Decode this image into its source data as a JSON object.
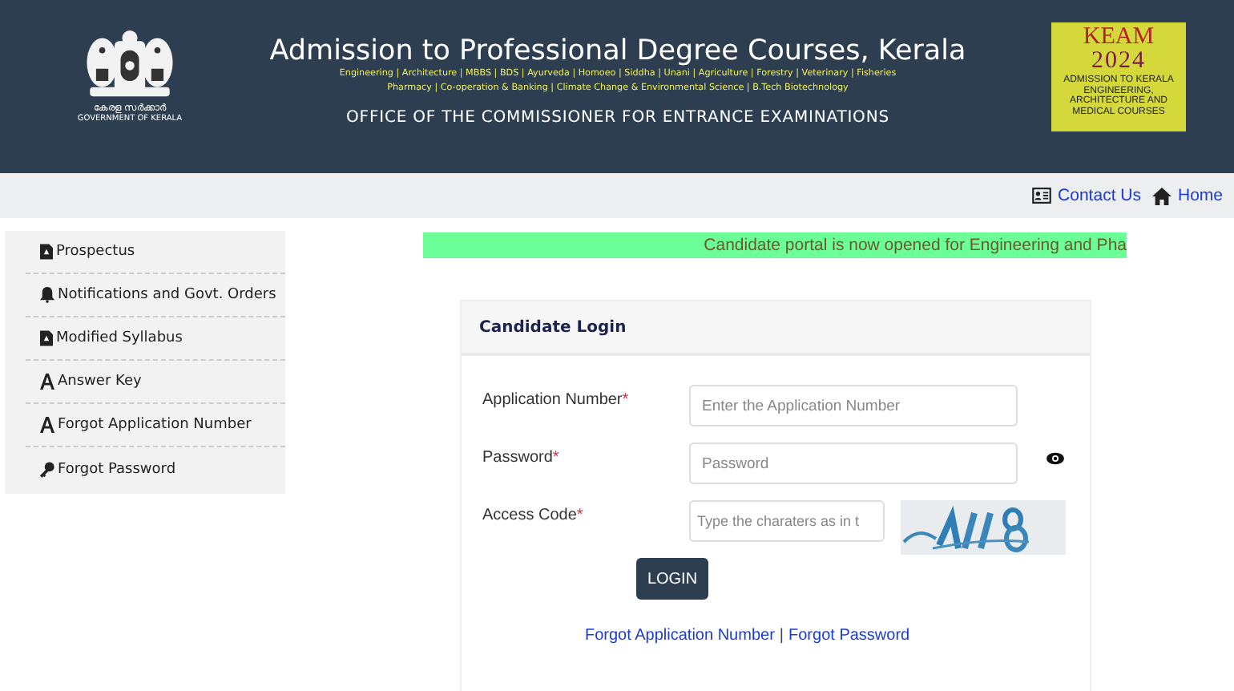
{
  "header": {
    "emblem_caption_ml": "കേരള സർക്കാർ",
    "emblem_caption_en": "GOVERNMENT OF KERALA",
    "title": "Admission to Professional Degree Courses, Kerala",
    "courses_line_1": "Engineering | Architecture | MBBS | BDS | Ayurveda | Homoeo | Siddha | Unani | Agriculture | Forestry | Veterinary | Fisheries",
    "courses_line_2": "Pharmacy | Co-operation & Banking | Climate Change & Environmental Science | B.Tech Biotechnology",
    "office": "OFFICE OF THE COMMISSIONER FOR ENTRANCE EXAMINATIONS",
    "logo": {
      "title": "KEAM",
      "year": "2024",
      "caption": "ADMISSION TO KERALA ENGINEERING, ARCHITECTURE AND MEDICAL COURSES"
    }
  },
  "top_links": [
    {
      "label": "Contact Us",
      "kind": "contact"
    },
    {
      "label": "Home",
      "kind": "home"
    }
  ],
  "sidebar": {
    "items": [
      {
        "label": "Prospectus",
        "kind": "document"
      },
      {
        "label": "Notifications and Govt. Orders",
        "kind": "bell"
      },
      {
        "label": "Modified Syllabus",
        "kind": "document"
      },
      {
        "label": "Answer Key",
        "kind": "font"
      },
      {
        "label": "Forgot Application Number",
        "kind": "font"
      },
      {
        "label": "Forgot Password",
        "kind": "key"
      }
    ]
  },
  "marquee": "Candidate portal is now opened for Engineering and Pha",
  "login": {
    "title": "Candidate Login",
    "fields": [
      {
        "label": "Application Number",
        "required_mark": "*",
        "placeholder": "Enter the Application Number",
        "kind": "text"
      },
      {
        "label": "Password",
        "required_mark": "*",
        "placeholder": "Password",
        "kind": "password"
      },
      {
        "label": "Access Code",
        "required_mark": "*",
        "placeholder": "Type the charaters as in t",
        "kind": "captcha"
      }
    ],
    "button": "LOGIN",
    "links": [
      "Forgot Application Number",
      "Forgot Password"
    ],
    "link_separator": "|"
  }
}
